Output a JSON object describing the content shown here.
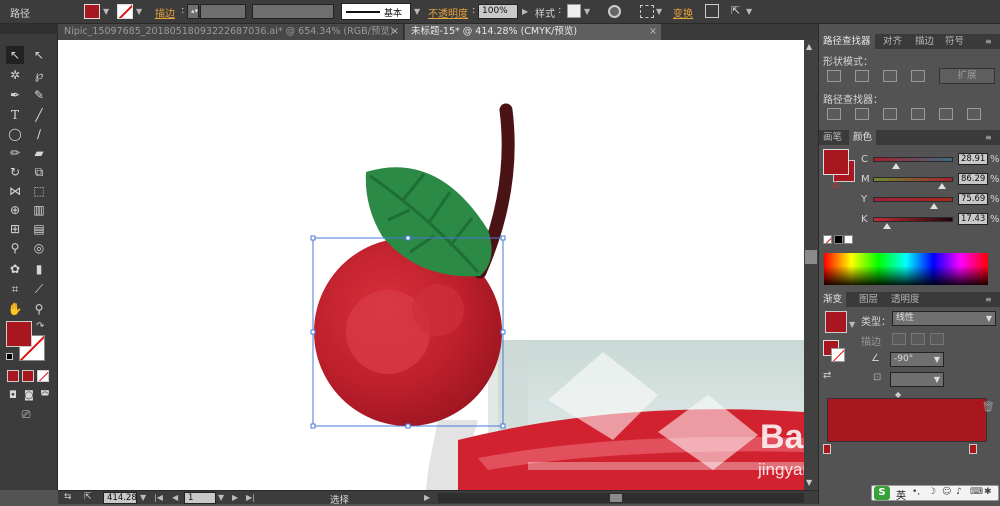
{
  "control_bar": {
    "object_type": "路径",
    "stroke_label": "描边",
    "stroke_weight": "",
    "brush_label": "基本",
    "opacity_label": "不透明度",
    "opacity_value": "100%",
    "style_label": "样式",
    "transform_label": "变换"
  },
  "doc_tabs": [
    {
      "title": "Nipic_15097685_20180518093222687036.ai* @ 654.34% (RGB/预览)",
      "close": "×"
    },
    {
      "title": "未标题-15* @ 414.28% (CMYK/预览)",
      "close": "×"
    }
  ],
  "status_bar": {
    "zoom": "414.28",
    "page": "1",
    "tool_name": "选择"
  },
  "pathfinder": {
    "tabs": [
      "路径查找器",
      "对齐",
      "描边",
      "符号"
    ],
    "shape_modes_label": "形状模式：",
    "expand_button": "扩展",
    "pathfinders_label": "路径查找器："
  },
  "color_panel": {
    "tabs": [
      "画笔",
      "颜色"
    ],
    "channels": [
      {
        "name": "C",
        "value": "28.91",
        "unit": "%",
        "position": 0.289
      },
      {
        "name": "M",
        "value": "86.29",
        "unit": "%",
        "position": 0.863
      },
      {
        "name": "Y",
        "value": "75.69",
        "unit": "%",
        "position": 0.757
      },
      {
        "name": "K",
        "value": "17.43",
        "unit": "%",
        "position": 0.174
      }
    ]
  },
  "gradient_panel": {
    "tabs": [
      "渐变",
      "图层",
      "透明度"
    ],
    "type_label": "类型：",
    "type_value": "线性",
    "stroke_label": "描边",
    "angle_value": "-90°"
  },
  "watermark": {
    "logo": "Bai",
    "url": "jingyan.baidu.com"
  },
  "ime_bar": {
    "lang": "英"
  },
  "colors": {
    "fill": "#a8171f",
    "cherry": "#c0202c",
    "leaf": "#2b8a45",
    "stem": "#4a1417",
    "glass_bg": "#d9e6e3",
    "liquid": "#d3222f",
    "selection": "#4a78d9"
  }
}
